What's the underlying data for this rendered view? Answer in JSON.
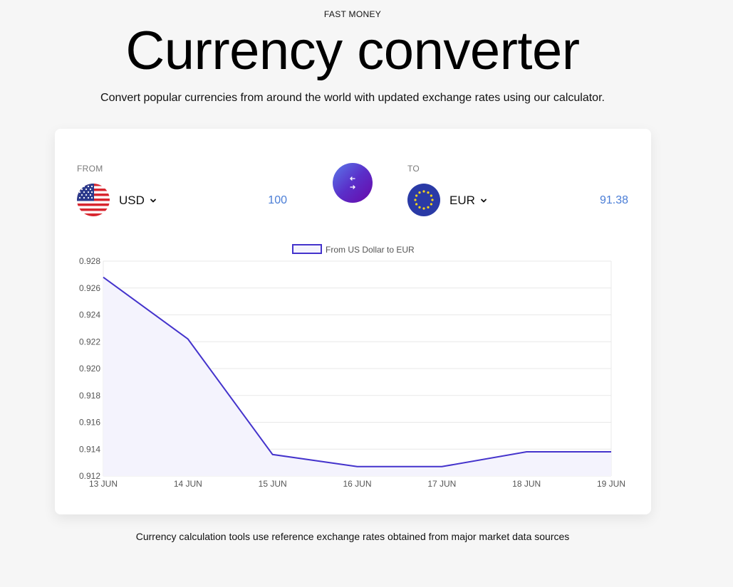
{
  "header": {
    "eyebrow": "FAST MONEY",
    "title": "Currency converter",
    "subtitle": "Convert popular currencies from around the world with updated exchange rates using our calculator."
  },
  "converter": {
    "from_label": "FROM",
    "to_label": "TO",
    "from_currency": "USD",
    "to_currency": "EUR",
    "from_flag": "us-flag-icon",
    "to_flag": "eu-flag-icon",
    "from_amount": "100",
    "to_amount": "91.38",
    "swap_icon": "swap-arrows-icon"
  },
  "colors": {
    "accent_blue": "#4a7dd6",
    "line": "#4433cc",
    "fill": "#f4f3fd",
    "swap_gradient_start": "#5b7bea",
    "swap_gradient_end": "#6a08a9"
  },
  "chart_data": {
    "type": "area",
    "x": [
      "13 JUN",
      "14 JUN",
      "15 JUN",
      "16 JUN",
      "17 JUN",
      "18 JUN",
      "19 JUN"
    ],
    "series": [
      {
        "name": "From US Dollar to EUR",
        "values": [
          0.9268,
          0.9222,
          0.9136,
          0.9127,
          0.9127,
          0.9138,
          0.9138
        ]
      }
    ],
    "yticks": [
      "0.928",
      "0.926",
      "0.924",
      "0.922",
      "0.920",
      "0.918",
      "0.916",
      "0.914",
      "0.912"
    ],
    "ylim": [
      0.912,
      0.928
    ],
    "grid": true,
    "legend_position": "top-center"
  },
  "footer": {
    "note": "Currency calculation tools use reference exchange rates obtained from major market data sources"
  }
}
